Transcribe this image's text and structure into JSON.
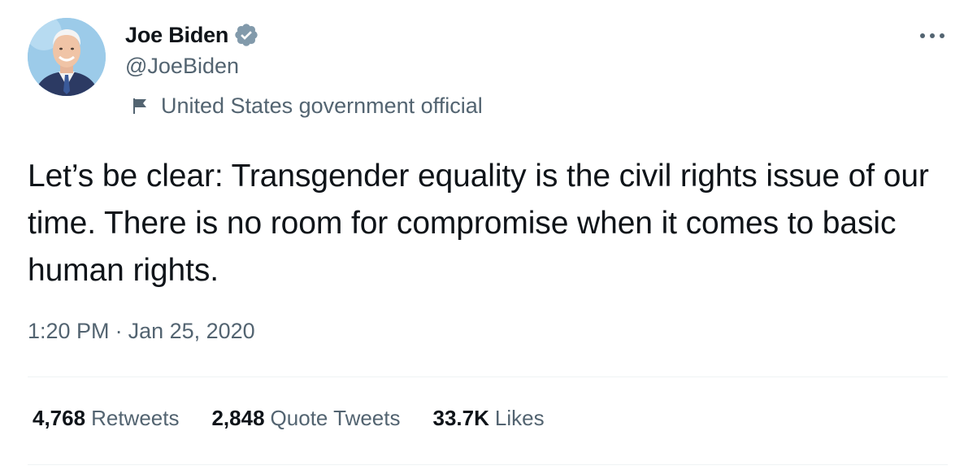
{
  "author": {
    "display_name": "Joe Biden",
    "handle": "@JoeBiden",
    "verified": true,
    "label": "United States government official",
    "avatar": "avatar-photo",
    "label_icon": "flag-icon",
    "verified_icon": "verified-badge-icon"
  },
  "menu": {
    "more_icon": "more-horizontal-icon"
  },
  "tweet": {
    "text": "Let’s be clear: Transgender equality is the civil rights issue of our time. There is no room for compromise when it comes to basic human rights.",
    "time": "1:20 PM",
    "separator": "·",
    "date": "Jan 25, 2020"
  },
  "stats": [
    {
      "count": "4,768",
      "label": "Retweets"
    },
    {
      "count": "2,848",
      "label": "Quote Tweets"
    },
    {
      "count": "33.7K",
      "label": "Likes"
    }
  ],
  "colors": {
    "text_primary": "#0f1419",
    "text_secondary": "#536471",
    "verified_badge": "#829aab",
    "divider": "#eff3f4"
  }
}
